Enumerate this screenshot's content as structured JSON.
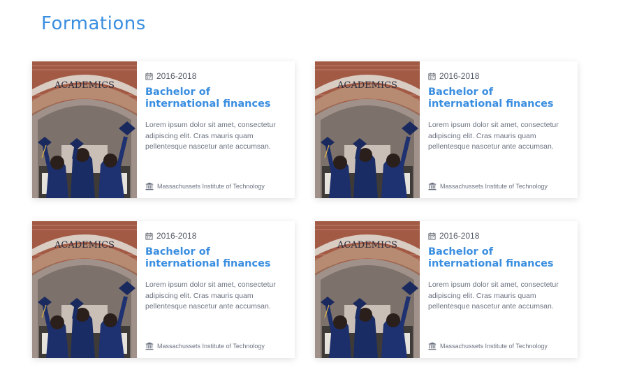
{
  "page": {
    "title": "Formations",
    "accent_color": "#3a8ee0"
  },
  "cards": [
    {
      "date": "2016-2018",
      "date_icon": "calendar-icon",
      "title": "Bachelor of international finances",
      "description": "Lorem ipsum dolor sit amet, consectetur adipiscing elit. Cras mauris quam pellentesque nascetur ante accumsan.",
      "school_icon": "institution-icon",
      "school": "Massachussets Institute of Technology",
      "image_sign": "ACADEMICS"
    },
    {
      "date": "2016-2018",
      "date_icon": "calendar-icon",
      "title": "Bachelor of international finances",
      "description": "Lorem ipsum dolor sit amet, consectetur adipiscing elit. Cras mauris quam pellentesque nascetur ante accumsan.",
      "school_icon": "institution-icon",
      "school": "Massachussets Institute of Technology",
      "image_sign": "ACADEMICS"
    },
    {
      "date": "2016-2018",
      "date_icon": "calendar-icon",
      "title": "Bachelor of international finances",
      "description": "Lorem ipsum dolor sit amet, consectetur adipiscing elit. Cras mauris quam pellentesque nascetur ante accumsan.",
      "school_icon": "institution-icon",
      "school": "Massachussets Institute of Technology",
      "image_sign": "ACADEMICS"
    },
    {
      "date": "2016-2018",
      "date_icon": "calendar-icon",
      "title": "Bachelor of international finances",
      "description": "Lorem ipsum dolor sit amet, consectetur adipiscing elit. Cras mauris quam pellentesque nascetur ante accumsan.",
      "school_icon": "institution-icon",
      "school": "Massachussets Institute of Technology",
      "image_sign": "ACADEMICS"
    }
  ]
}
